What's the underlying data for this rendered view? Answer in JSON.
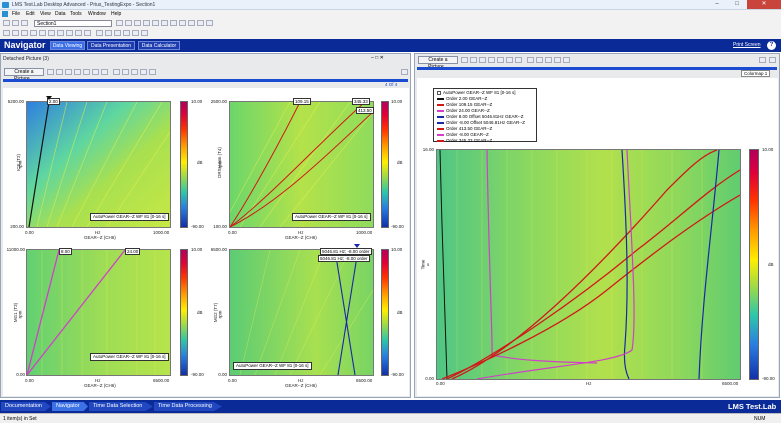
{
  "window": {
    "title": "LMS Test.Lab Desktop Advanced - Prius_TestingExpo - Section1"
  },
  "menu": [
    "File",
    "Edit",
    "View",
    "Data",
    "Tools",
    "Window",
    "Help"
  ],
  "toolbar": {
    "section_value": "Section1"
  },
  "navigator": {
    "title": "Navigator",
    "tabs": [
      {
        "label": "Data Viewing",
        "active": true
      },
      {
        "label": "Data Presentation",
        "active": false
      },
      {
        "label": "Data Calculator",
        "active": false
      }
    ],
    "print_screen": "Print Screen"
  },
  "left_panel": {
    "title": "Detached Picture (3)",
    "create_button": "Create a Picture...",
    "page_indicator": "4 Of 4",
    "plots": [
      {
        "ylabel": "ICE (T2)",
        "yunit": "rpm",
        "ytop": "5200.00",
        "ybottom": "200.00",
        "xunit": "Hz",
        "xleft": "0.00",
        "xright": "1000.00",
        "xlabel": "GEAR--Z (CH6)",
        "caption": "AutoPower GEAR--Z WF 81 [0-16 s]",
        "cursor": "2.00",
        "cbar_top": "10.00",
        "cbar_bottom": "-90.00",
        "cbar_unit": "dB"
      },
      {
        "ylabel": "DRSH-Nm (T4)",
        "yunit": "rpm",
        "ytop": "2500.00",
        "ybottom": "100.00",
        "xunit": "Hz",
        "xleft": "0.00",
        "xright": "1000.00",
        "xlabel": "GEAR--Z (CH6)",
        "caption": "AutoPower GEAR--Z WF 81 [0-16 s]",
        "cursors": [
          "109.15",
          "345.33",
          "413.50"
        ],
        "cbar_top": "10.00",
        "cbar_bottom": "-90.00",
        "cbar_unit": "dB"
      },
      {
        "ylabel": "MG1 (T3)",
        "yunit": "rpm",
        "ytop": "11000.00",
        "ybottom": "0.00",
        "xunit": "Hz",
        "xleft": "0.00",
        "xright": "6500.00",
        "xlabel": "GEAR--Z (CH6)",
        "caption": "AutoPower GEAR--Z WF 81 [0-16 s]",
        "cursors": [
          "8.00",
          "24.00"
        ],
        "cbar_top": "10.00",
        "cbar_bottom": "-90.00",
        "cbar_unit": "dB"
      },
      {
        "ylabel": "MG2 (T7)",
        "yunit": "rpm",
        "ytop": "6500.00",
        "ybottom": "0.00",
        "xunit": "Hz",
        "xleft": "0.00",
        "xright": "6500.00",
        "xlabel": "GEAR--Z (CH6)",
        "caption": "AutoPower GEAR--Z WF 81 [0-16 s]",
        "cursors": [
          "5046.81 Hz; -8.00 order",
          "5046.81 Hz; -8.00 order"
        ],
        "cbar_top": "10.00",
        "cbar_bottom": "-90.00",
        "cbar_unit": "dB"
      }
    ]
  },
  "right_panel": {
    "create_button": "Create a Picture...",
    "column_label": "Colormap 1",
    "ylabel": "Time",
    "yunit": "s",
    "ytop": "16.00",
    "ybottom": "0.00",
    "xunit": "Hz",
    "xleft": "0.00",
    "xright": "6500.00",
    "cbar_top": "10.00",
    "cbar_bottom": "-90.00",
    "cbar_unit": "dB",
    "legend": [
      {
        "label": "AutoPower GEAR--Z WF 81 [0-16 s]",
        "color": "#ffffff"
      },
      {
        "label": "Order 2.00 GEAR--Z",
        "color": "#111111"
      },
      {
        "label": "Order 109.15 GEAR--Z",
        "color": "#d01818"
      },
      {
        "label": "Order 24.00 GEAR--Z",
        "color": "#d040c8"
      },
      {
        "label": "Order 8.00 Offset 5046.81Hz GEAR--Z",
        "color": "#1828a8"
      },
      {
        "label": "Order -8.00 Offset 5046.81Hz GEAR--Z",
        "color": "#1828a8"
      },
      {
        "label": "Order 413.50 GEAR--Z",
        "color": "#d01818"
      },
      {
        "label": "Order -8.00 GEAR--Z",
        "color": "#d040c8"
      },
      {
        "label": "Order 345.33 GEAR--Z",
        "color": "#d01818"
      }
    ]
  },
  "workflow": {
    "steps": [
      "Documentation",
      "Navigator",
      "Time Data Selection",
      "Time Data Processing"
    ],
    "active": "Navigator",
    "brand": "LMS Test.Lab"
  },
  "status": {
    "left": "1 item(s) in Set",
    "right": "NUM"
  }
}
